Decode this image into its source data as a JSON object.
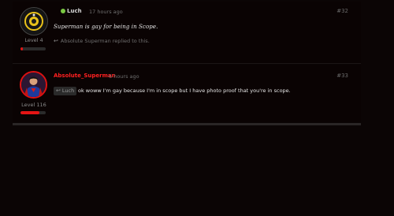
{
  "posts": [
    {
      "username": "Luch",
      "time": "17 hours ago",
      "number": "#32",
      "level": "Level 4",
      "xp_fraction": 0.08,
      "handwritten": "Superman is gay for being in Scope.",
      "reply_text": "Absolute Superman replied to this.",
      "username_color": "#d7d7d7",
      "online": true
    },
    {
      "username": "Absolute_Superman",
      "time": "6 hours ago",
      "number": "#33",
      "level": "Level 116",
      "xp_fraction": 0.75,
      "quote_chip": "Luch",
      "body": "ok woww I'm gay because I'm in scope but I have photo proof that you're in scope.",
      "username_color": "#ff2020"
    }
  ],
  "colors": {
    "accent": "#e51414",
    "online": "#7ac943",
    "background": "#0a0303"
  }
}
